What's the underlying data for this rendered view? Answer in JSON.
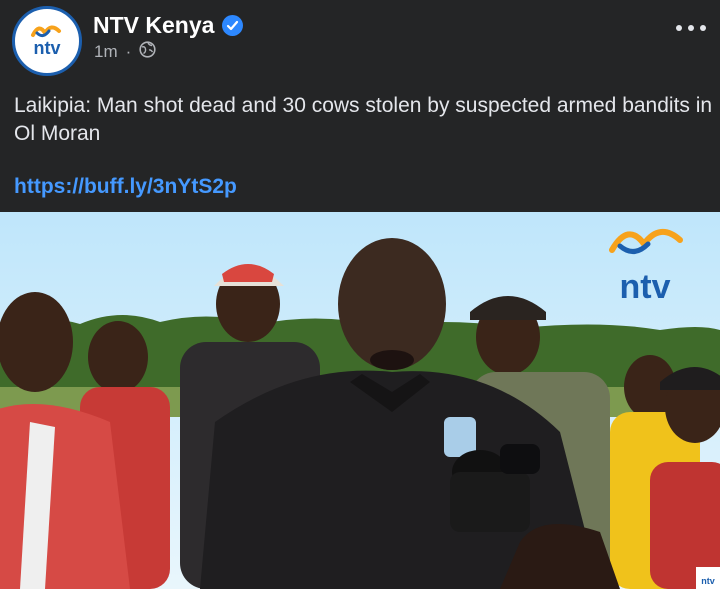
{
  "post": {
    "page_name": "NTV Kenya",
    "time_ago": "1m",
    "separator": "·",
    "audience_icon": "globe-icon",
    "verified_icon": "verified-badge-icon",
    "more_icon": "more-options-icon",
    "text": "Laikipia: Man shot dead and 30 cows stolen by suspected armed bandits in Ol Moran",
    "link": "https://buff.ly/3nYtS2p"
  },
  "avatar": {
    "logo_text": "ntv"
  },
  "media": {
    "watermark_text": "ntv",
    "corner_badge_text": "ntv"
  },
  "colors": {
    "background": "#242526",
    "text": "#e4e6eb",
    "link": "#4599ff",
    "verified": "#2d88ff",
    "ntv_blue": "#1c5fae"
  }
}
